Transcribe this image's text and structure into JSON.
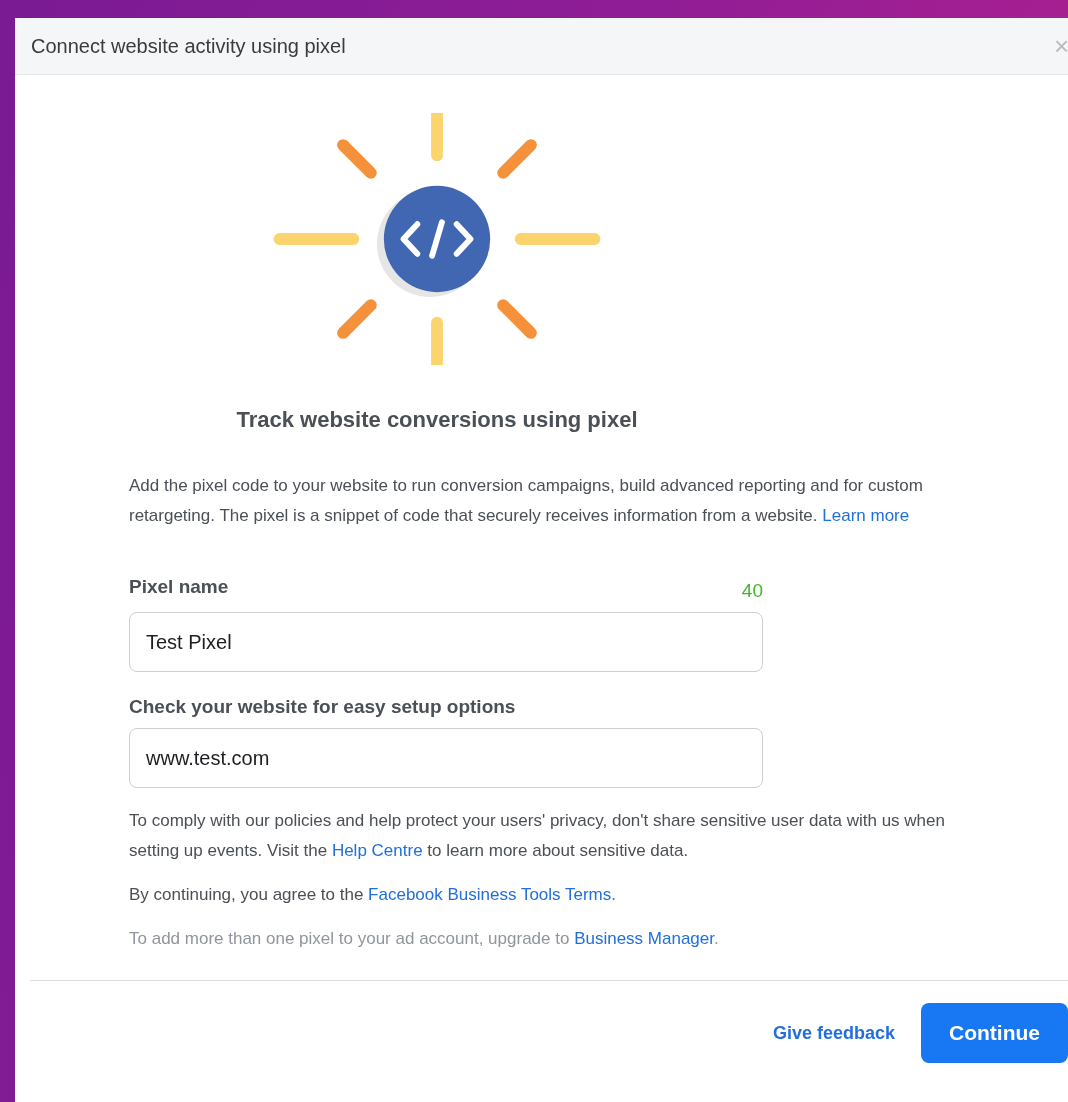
{
  "dialog": {
    "title": "Connect website activity using pixel",
    "close": "×"
  },
  "heading": "Track website conversions using pixel",
  "intro": [
    {
      "kind": "text",
      "text": "Add the pixel code to your website to run conversion campaigns, build advanced reporting and for custom retargeting. The pixel is a snippet of code that securely receives information from a website. "
    },
    {
      "kind": "link",
      "text": "Learn more"
    }
  ],
  "fields": [
    {
      "label": "Pixel name",
      "counter": "40",
      "value": "Test Pixel"
    },
    {
      "label": "Check your website for easy setup options",
      "value": "www.test.com"
    }
  ],
  "notes": [
    {
      "muted": false,
      "parts": [
        {
          "kind": "text",
          "text": "To comply with our policies and help protect your users' privacy, don't share sensitive user data with us when setting up events. Visit the "
        },
        {
          "kind": "link",
          "text": "Help Centre"
        },
        {
          "kind": "text",
          "text": " to learn more about sensitive data."
        }
      ]
    },
    {
      "muted": false,
      "parts": [
        {
          "kind": "text",
          "text": "By continuing, you agree to the "
        },
        {
          "kind": "link",
          "text": "Facebook Business Tools Terms."
        }
      ]
    },
    {
      "muted": true,
      "parts": [
        {
          "kind": "text",
          "text": "To add more than one pixel to your ad account, upgrade to "
        },
        {
          "kind": "link",
          "text": "Business Manager"
        },
        {
          "kind": "text",
          "text": "."
        }
      ]
    }
  ],
  "footer": {
    "feedback": "Give feedback",
    "primary": "Continue"
  }
}
